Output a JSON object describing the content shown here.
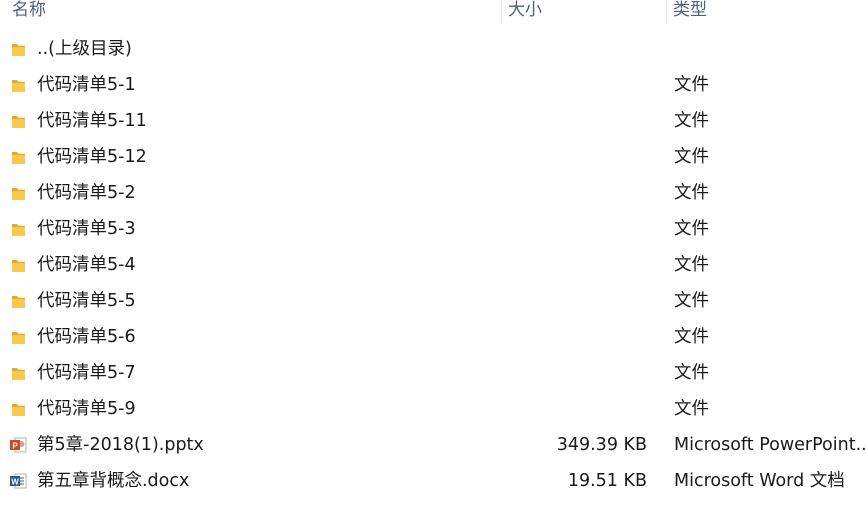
{
  "columns": {
    "name": "名称",
    "size": "大小",
    "type": "类型"
  },
  "rows": [
    {
      "name": "..(上级目录)",
      "size": "",
      "type": "",
      "icon": "folder-icon"
    },
    {
      "name": "代码清单5-1",
      "size": "",
      "type": "文件",
      "icon": "folder-icon"
    },
    {
      "name": "代码清单5-11",
      "size": "",
      "type": "文件",
      "icon": "folder-icon"
    },
    {
      "name": "代码清单5-12",
      "size": "",
      "type": "文件",
      "icon": "folder-icon"
    },
    {
      "name": "代码清单5-2",
      "size": "",
      "type": "文件",
      "icon": "folder-icon"
    },
    {
      "name": "代码清单5-3",
      "size": "",
      "type": "文件",
      "icon": "folder-icon"
    },
    {
      "name": "代码清单5-4",
      "size": "",
      "type": "文件",
      "icon": "folder-icon"
    },
    {
      "name": "代码清单5-5",
      "size": "",
      "type": "文件",
      "icon": "folder-icon"
    },
    {
      "name": "代码清单5-6",
      "size": "",
      "type": "文件",
      "icon": "folder-icon"
    },
    {
      "name": "代码清单5-7",
      "size": "",
      "type": "文件",
      "icon": "folder-icon"
    },
    {
      "name": "代码清单5-9",
      "size": "",
      "type": "文件",
      "icon": "folder-icon"
    },
    {
      "name": "第5章-2018(1).pptx",
      "size": "349.39 KB",
      "type": "Microsoft PowerPoint..",
      "icon": "powerpoint-file-icon"
    },
    {
      "name": "第五章背概念.docx",
      "size": "19.51 KB",
      "type": "Microsoft Word 文档",
      "icon": "word-file-icon"
    }
  ],
  "colors": {
    "folder": "#f8c94a",
    "folder_dark": "#e3a92b",
    "powerpoint": "#c84a29",
    "word": "#2b5797",
    "header_text": "#4d6082"
  }
}
